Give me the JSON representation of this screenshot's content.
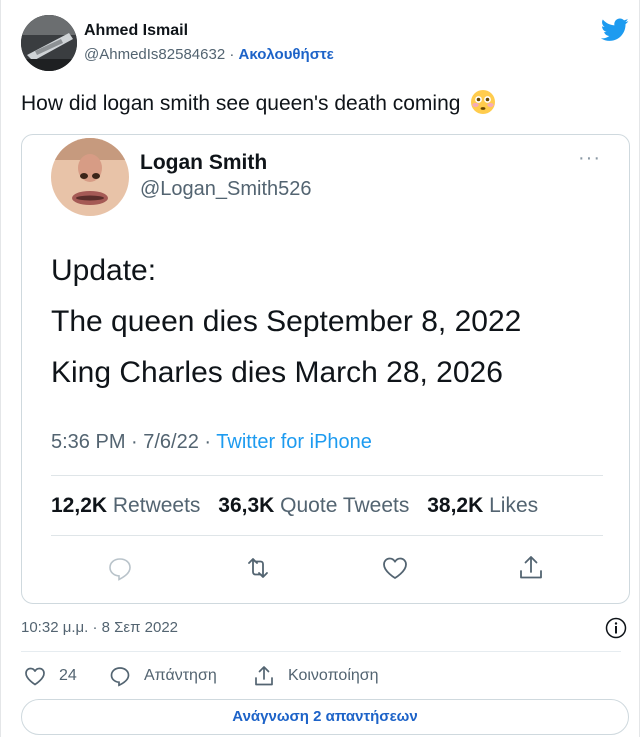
{
  "author": {
    "name": "Ahmed Ismail",
    "handle": "@AhmedIs82584632",
    "separator": "·",
    "follow_label": "Ακολουθήστε"
  },
  "tweet": {
    "text": "How did logan smith see queen's death coming",
    "emoji": "flushed-face-emoji"
  },
  "quoted_tweet": {
    "name": "Logan Smith",
    "handle": "@Logan_Smith526",
    "more_label": "···",
    "lines": [
      "Update:",
      "The queen dies September 8, 2022",
      "King Charles dies March 28, 2026"
    ],
    "time": "5:36 PM · 7/6/22 · ",
    "source": "Twitter for iPhone",
    "stats": {
      "retweets_count": "12,2K",
      "retweets_label": "Retweets",
      "quotes_count": "36,3K",
      "quotes_label": "Quote Tweets",
      "likes_count": "38,2K",
      "likes_label": "Likes"
    },
    "icons": [
      "reply-icon",
      "retweet-icon",
      "like-icon",
      "share-icon"
    ]
  },
  "timestamp": "10:32 μ.μ. · 8 Σεπ 2022",
  "actions": {
    "like_count": "24",
    "reply_label": "Απάντηση",
    "share_label": "Κοινοποίηση"
  },
  "read_replies_label": "Ανάγνωση 2 απαντήσεων",
  "colors": {
    "accent": "#1d9bf0",
    "link": "#1d63c8",
    "text": "#0f1419",
    "muted": "#536471",
    "border": "#cfd9de"
  }
}
